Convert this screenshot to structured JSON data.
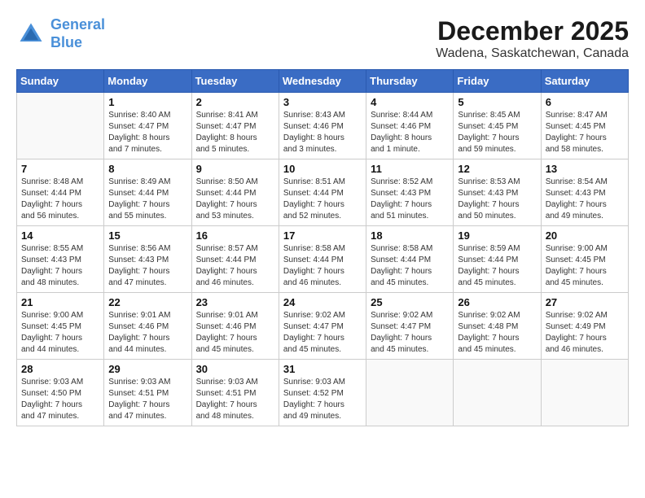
{
  "header": {
    "logo_line1": "General",
    "logo_line2": "Blue",
    "month_title": "December 2025",
    "location": "Wadena, Saskatchewan, Canada"
  },
  "days_of_week": [
    "Sunday",
    "Monday",
    "Tuesday",
    "Wednesday",
    "Thursday",
    "Friday",
    "Saturday"
  ],
  "weeks": [
    [
      {
        "day": "",
        "info": ""
      },
      {
        "day": "1",
        "info": "Sunrise: 8:40 AM\nSunset: 4:47 PM\nDaylight: 8 hours\nand 7 minutes."
      },
      {
        "day": "2",
        "info": "Sunrise: 8:41 AM\nSunset: 4:47 PM\nDaylight: 8 hours\nand 5 minutes."
      },
      {
        "day": "3",
        "info": "Sunrise: 8:43 AM\nSunset: 4:46 PM\nDaylight: 8 hours\nand 3 minutes."
      },
      {
        "day": "4",
        "info": "Sunrise: 8:44 AM\nSunset: 4:46 PM\nDaylight: 8 hours\nand 1 minute."
      },
      {
        "day": "5",
        "info": "Sunrise: 8:45 AM\nSunset: 4:45 PM\nDaylight: 7 hours\nand 59 minutes."
      },
      {
        "day": "6",
        "info": "Sunrise: 8:47 AM\nSunset: 4:45 PM\nDaylight: 7 hours\nand 58 minutes."
      }
    ],
    [
      {
        "day": "7",
        "info": "Sunrise: 8:48 AM\nSunset: 4:44 PM\nDaylight: 7 hours\nand 56 minutes."
      },
      {
        "day": "8",
        "info": "Sunrise: 8:49 AM\nSunset: 4:44 PM\nDaylight: 7 hours\nand 55 minutes."
      },
      {
        "day": "9",
        "info": "Sunrise: 8:50 AM\nSunset: 4:44 PM\nDaylight: 7 hours\nand 53 minutes."
      },
      {
        "day": "10",
        "info": "Sunrise: 8:51 AM\nSunset: 4:44 PM\nDaylight: 7 hours\nand 52 minutes."
      },
      {
        "day": "11",
        "info": "Sunrise: 8:52 AM\nSunset: 4:43 PM\nDaylight: 7 hours\nand 51 minutes."
      },
      {
        "day": "12",
        "info": "Sunrise: 8:53 AM\nSunset: 4:43 PM\nDaylight: 7 hours\nand 50 minutes."
      },
      {
        "day": "13",
        "info": "Sunrise: 8:54 AM\nSunset: 4:43 PM\nDaylight: 7 hours\nand 49 minutes."
      }
    ],
    [
      {
        "day": "14",
        "info": "Sunrise: 8:55 AM\nSunset: 4:43 PM\nDaylight: 7 hours\nand 48 minutes."
      },
      {
        "day": "15",
        "info": "Sunrise: 8:56 AM\nSunset: 4:43 PM\nDaylight: 7 hours\nand 47 minutes."
      },
      {
        "day": "16",
        "info": "Sunrise: 8:57 AM\nSunset: 4:44 PM\nDaylight: 7 hours\nand 46 minutes."
      },
      {
        "day": "17",
        "info": "Sunrise: 8:58 AM\nSunset: 4:44 PM\nDaylight: 7 hours\nand 46 minutes."
      },
      {
        "day": "18",
        "info": "Sunrise: 8:58 AM\nSunset: 4:44 PM\nDaylight: 7 hours\nand 45 minutes."
      },
      {
        "day": "19",
        "info": "Sunrise: 8:59 AM\nSunset: 4:44 PM\nDaylight: 7 hours\nand 45 minutes."
      },
      {
        "day": "20",
        "info": "Sunrise: 9:00 AM\nSunset: 4:45 PM\nDaylight: 7 hours\nand 45 minutes."
      }
    ],
    [
      {
        "day": "21",
        "info": "Sunrise: 9:00 AM\nSunset: 4:45 PM\nDaylight: 7 hours\nand 44 minutes."
      },
      {
        "day": "22",
        "info": "Sunrise: 9:01 AM\nSunset: 4:46 PM\nDaylight: 7 hours\nand 44 minutes."
      },
      {
        "day": "23",
        "info": "Sunrise: 9:01 AM\nSunset: 4:46 PM\nDaylight: 7 hours\nand 45 minutes."
      },
      {
        "day": "24",
        "info": "Sunrise: 9:02 AM\nSunset: 4:47 PM\nDaylight: 7 hours\nand 45 minutes."
      },
      {
        "day": "25",
        "info": "Sunrise: 9:02 AM\nSunset: 4:47 PM\nDaylight: 7 hours\nand 45 minutes."
      },
      {
        "day": "26",
        "info": "Sunrise: 9:02 AM\nSunset: 4:48 PM\nDaylight: 7 hours\nand 45 minutes."
      },
      {
        "day": "27",
        "info": "Sunrise: 9:02 AM\nSunset: 4:49 PM\nDaylight: 7 hours\nand 46 minutes."
      }
    ],
    [
      {
        "day": "28",
        "info": "Sunrise: 9:03 AM\nSunset: 4:50 PM\nDaylight: 7 hours\nand 47 minutes."
      },
      {
        "day": "29",
        "info": "Sunrise: 9:03 AM\nSunset: 4:51 PM\nDaylight: 7 hours\nand 47 minutes."
      },
      {
        "day": "30",
        "info": "Sunrise: 9:03 AM\nSunset: 4:51 PM\nDaylight: 7 hours\nand 48 minutes."
      },
      {
        "day": "31",
        "info": "Sunrise: 9:03 AM\nSunset: 4:52 PM\nDaylight: 7 hours\nand 49 minutes."
      },
      {
        "day": "",
        "info": ""
      },
      {
        "day": "",
        "info": ""
      },
      {
        "day": "",
        "info": ""
      }
    ]
  ]
}
